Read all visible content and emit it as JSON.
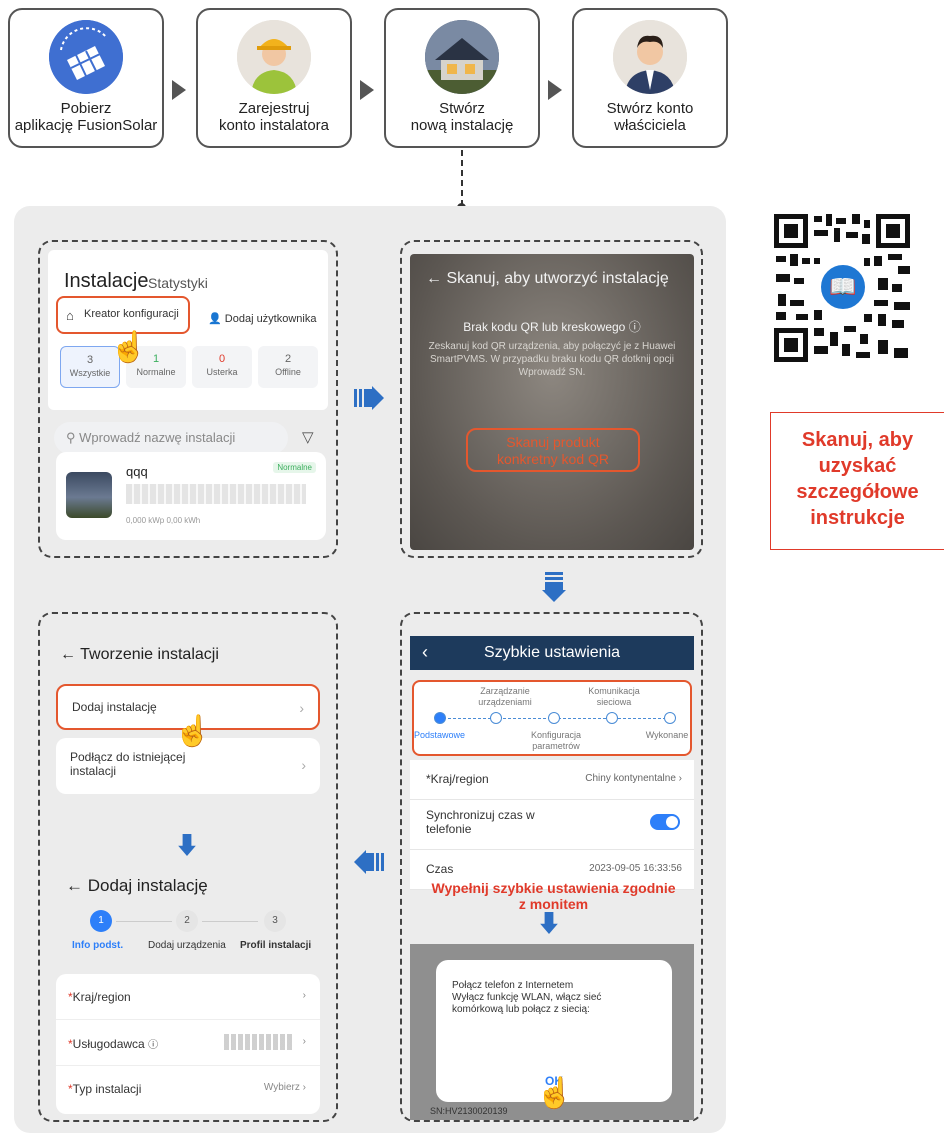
{
  "steps": [
    {
      "label1": "Pobierz",
      "label2": "aplikację FusionSolar",
      "icon": "solar-app-icon"
    },
    {
      "label1": "Zarejestruj",
      "label2": "konto instalatora",
      "icon": "installer-avatar"
    },
    {
      "label1": "Stwórz",
      "label2": "nową instalację",
      "icon": "house-icon"
    },
    {
      "label1": "Stwórz konto",
      "label2": "właściciela",
      "icon": "owner-avatar"
    }
  ],
  "panel1": {
    "title": "Instalacje",
    "subtitle": "Statystyki",
    "kreator": "Kreator konfiguracji",
    "add_user": "Dodaj użytkownika",
    "stats": [
      {
        "n": "3",
        "label": "Wszystkie",
        "color": "#333333"
      },
      {
        "n": "1",
        "label": "Normalne",
        "color": "#3caf5e"
      },
      {
        "n": "0",
        "label": "Usterka",
        "color": "#e03a2a"
      },
      {
        "n": "2",
        "label": "Offline",
        "color": "#888888"
      }
    ],
    "search_placeholder": "Wprowadź nazwę instalacji",
    "plant_name": "qqq",
    "plant_tag": "Normalne",
    "plant_meta": "0,000 kWp   0,00 kWh"
  },
  "panel2": {
    "header": "Skanuj, aby utworzyć instalację",
    "no_qr": "Brak kodu QR lub kreskowego",
    "desc": "Zeskanuj kod QR urządzenia, aby połączyć je z Huawei SmartPVMS. W przypadku braku kodu QR dotknij opcji Wprowadź SN.",
    "button_line1": "Skanuj produkt",
    "button_line2": "konkretny kod QR"
  },
  "panel3": {
    "title": "Szybkie ustawienia",
    "steps_top": [
      "Zarządzanie urządzeniami",
      "Komunikacja sieciowa"
    ],
    "steps_bottom": [
      "Podstawowe",
      "Konfiguracja parametrów",
      "Wykonane"
    ],
    "region_label": "*Kraj/region",
    "region_value": "Chiny kontynentalne",
    "sync_label": "Synchronizuj czas w telefonie",
    "time_label": "Czas",
    "time_value": "2023-09-05 16:33:56",
    "hint_line1": "Wypełnij szybkie ustawienia zgodnie",
    "hint_line2": "z monitem",
    "dialog_text1": "Połącz telefon z Internetem",
    "dialog_text2": "Wyłącz funkcję WLAN, włącz sieć",
    "dialog_text3": "komórkową lub połącz z siecią:",
    "ok": "OK",
    "bg_text": "SN:HV2130020139"
  },
  "panel4": {
    "header": "Tworzenie instalacji",
    "opt1": "Dodaj instalację",
    "opt2_line1": "Podłącz do istniejącej",
    "opt2_line2": "instalacji",
    "header2": "Dodaj instalację",
    "step_labels": [
      "Info podst.",
      "Dodaj urządzenia",
      "Profil instalacji"
    ],
    "rows": [
      {
        "label": "Kraj/region",
        "value": ""
      },
      {
        "label": "Usługodawca",
        "value": ""
      },
      {
        "label": "Typ instalacji",
        "value": "Wybierz"
      }
    ]
  },
  "right": {
    "qr_icon": "manual-reader-icon",
    "line1": "Skanuj, aby",
    "line2": "uzyskać",
    "line3": "szczegółowe",
    "line4": "instrukcje"
  },
  "colors": {
    "accent": "#e4572e",
    "blue": "#2d7ff9",
    "red": "#e03a2a",
    "navy": "#1d3a5c"
  }
}
